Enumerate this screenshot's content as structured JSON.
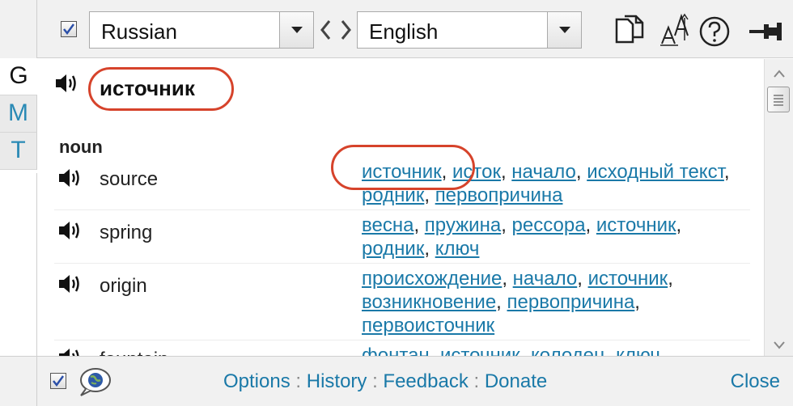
{
  "toolbar": {
    "source_lang": "Russian",
    "target_lang": "English",
    "checkbox_checked": true
  },
  "sidetabs": [
    "G",
    "M",
    "T"
  ],
  "entry": {
    "headword": "источник",
    "part_of_speech": "noun",
    "rows": [
      {
        "term": "source",
        "translations": [
          "источник",
          "исток",
          "начало",
          "исходный текст",
          "родник",
          "первопричина"
        ]
      },
      {
        "term": "spring",
        "translations": [
          "весна",
          "пружина",
          "рессора",
          "источник",
          "родник",
          "ключ"
        ]
      },
      {
        "term": "origin",
        "translations": [
          "происхождение",
          "начало",
          "источник",
          "возникновение",
          "первопричина",
          "первоисточник"
        ]
      },
      {
        "term": "fountain",
        "translations": [
          "фонтан",
          "источник",
          "колодец",
          "ключ"
        ]
      }
    ]
  },
  "footer": {
    "checkbox_checked": true,
    "links": [
      "Options",
      "History",
      "Feedback",
      "Donate"
    ],
    "separator": ":",
    "close_label": "Close"
  },
  "colors": {
    "link": "#1a79a8",
    "annotation": "#d6432b",
    "chrome": "#f1f1f1"
  },
  "icons": [
    "checkbox-icon",
    "dropdown-arrow-icon",
    "swap-icon",
    "copy-icon",
    "font-size-icon",
    "help-icon",
    "pin-icon",
    "speaker-icon",
    "globe-chat-icon"
  ]
}
